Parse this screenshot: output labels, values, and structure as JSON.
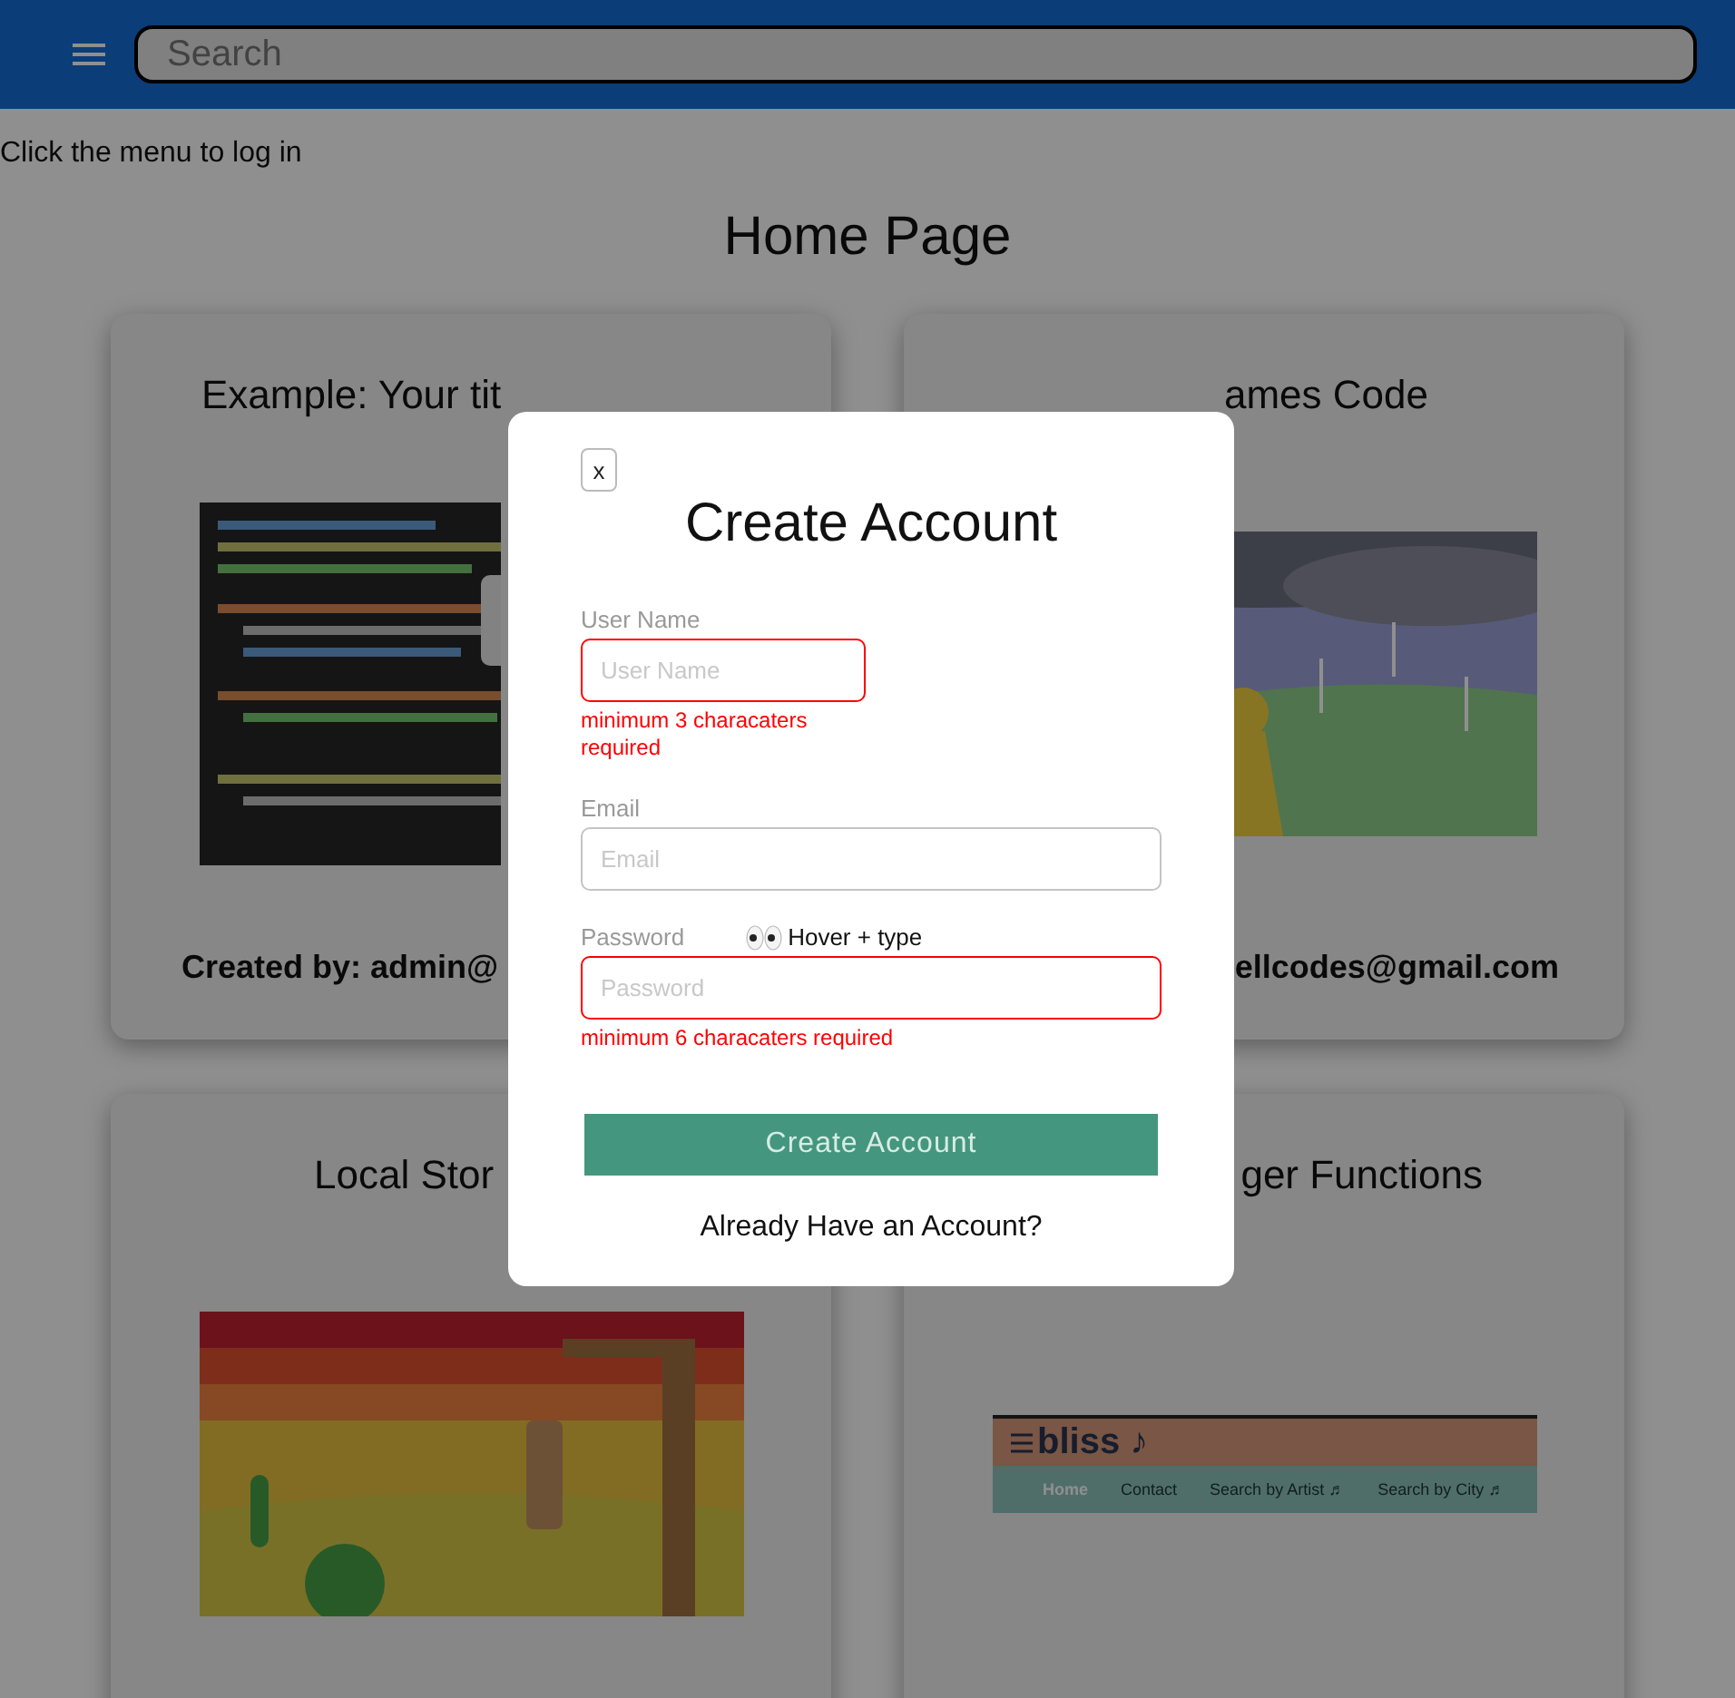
{
  "header": {
    "search": {
      "placeholder": "Search"
    }
  },
  "notice": "Click the menu to log in",
  "page_title": "Home Page",
  "cards": [
    {
      "title": "Example: Your tit",
      "footer": "Created by: admin@"
    },
    {
      "title": "ames Code",
      "footer": "ellcodes@gmail.com"
    },
    {
      "title": "Local Stor"
    },
    {
      "title": "ger Functions",
      "image": {
        "kind": "screenshot",
        "logo": "bliss ♪",
        "nav": [
          {
            "label": "Home",
            "selected": true
          },
          {
            "label": "Contact",
            "selected": false
          },
          {
            "label": "Search by Artist ♬",
            "selected": false
          },
          {
            "label": "Search by City ♬",
            "selected": false
          }
        ]
      }
    }
  ],
  "modal": {
    "close": "x",
    "title": "Create Account",
    "fields": [
      {
        "kind": "short",
        "label": "User Name",
        "placeholder": "User Name",
        "error": "minimum 3 characaters required"
      },
      {
        "kind": "full",
        "label": "Email",
        "placeholder": "Email"
      },
      {
        "kind": "full",
        "label": "Password",
        "placeholder": "Password",
        "hint": "Hover + type",
        "error": "minimum 6 characaters required"
      }
    ],
    "submit": "Create Account",
    "switch_link": "Already Have an Account?"
  }
}
